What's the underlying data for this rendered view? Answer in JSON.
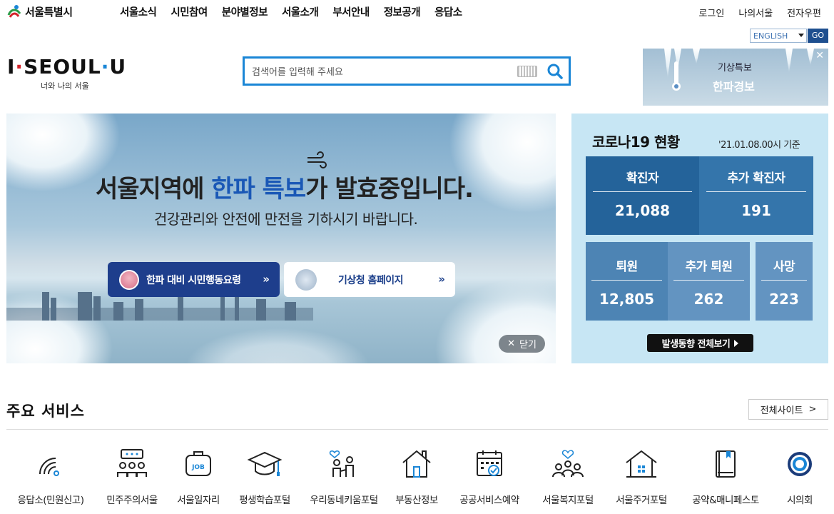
{
  "header": {
    "city_name": "서울특별시",
    "menu": [
      "서울소식",
      "시민참여",
      "분야별정보",
      "서울소개",
      "부서안내",
      "정보공개",
      "응답소"
    ],
    "util": [
      "로그인",
      "나의서울",
      "전자우편"
    ],
    "lang_value": "ENGLISH",
    "lang_go": "GO"
  },
  "brand": {
    "word_i": "I",
    "word_seoul": "SEOUL",
    "word_u": "U",
    "tagline": "너와 나의 서울"
  },
  "search": {
    "placeholder": "검색어를 입력해 주세요"
  },
  "weather_banner": {
    "line1": "기상특보",
    "line2": "한파경보",
    "close": "✕"
  },
  "hero": {
    "headline_pre": "서울지역에 ",
    "headline_highlight": "한파 특보",
    "headline_post": "가 발효중입니다.",
    "subline": "건강관리와 안전에 만전을 기하시기 바랍니다.",
    "btn_guide": "한파 대비 시민행동요령",
    "btn_kma": "기상청 홈페이지",
    "close_label": "닫기"
  },
  "covid": {
    "title": "코로나19 현황",
    "base_time": "'21.01.08.00시 기준",
    "confirmed_label": "확진자",
    "confirmed_value": "21,088",
    "new_confirmed_label": "추가 확진자",
    "new_confirmed_value": "191",
    "discharged_label": "퇴원",
    "discharged_value": "12,805",
    "new_discharged_label": "추가 퇴원",
    "new_discharged_value": "262",
    "deaths_label": "사망",
    "deaths_value": "223",
    "more_label": "발생동향 전체보기"
  },
  "services": {
    "title": "주요 서비스",
    "all_sites": "전체사이트",
    "items": [
      "응답소(민원신고)",
      "민주주의서울",
      "서울일자리",
      "평생학습포털",
      "우리동네키움포털",
      "부동산정보",
      "공공서비스예약",
      "서울복지포털",
      "서울주거포털",
      "공약&매니페스토",
      "시의회"
    ]
  },
  "colors": {
    "accent_blue": "#1a86d6",
    "hero_highlight": "#1a58b6",
    "covid_bg": "#c7e6f4",
    "covid_dark": "#24639a",
    "brand_red": "#d3232a"
  }
}
